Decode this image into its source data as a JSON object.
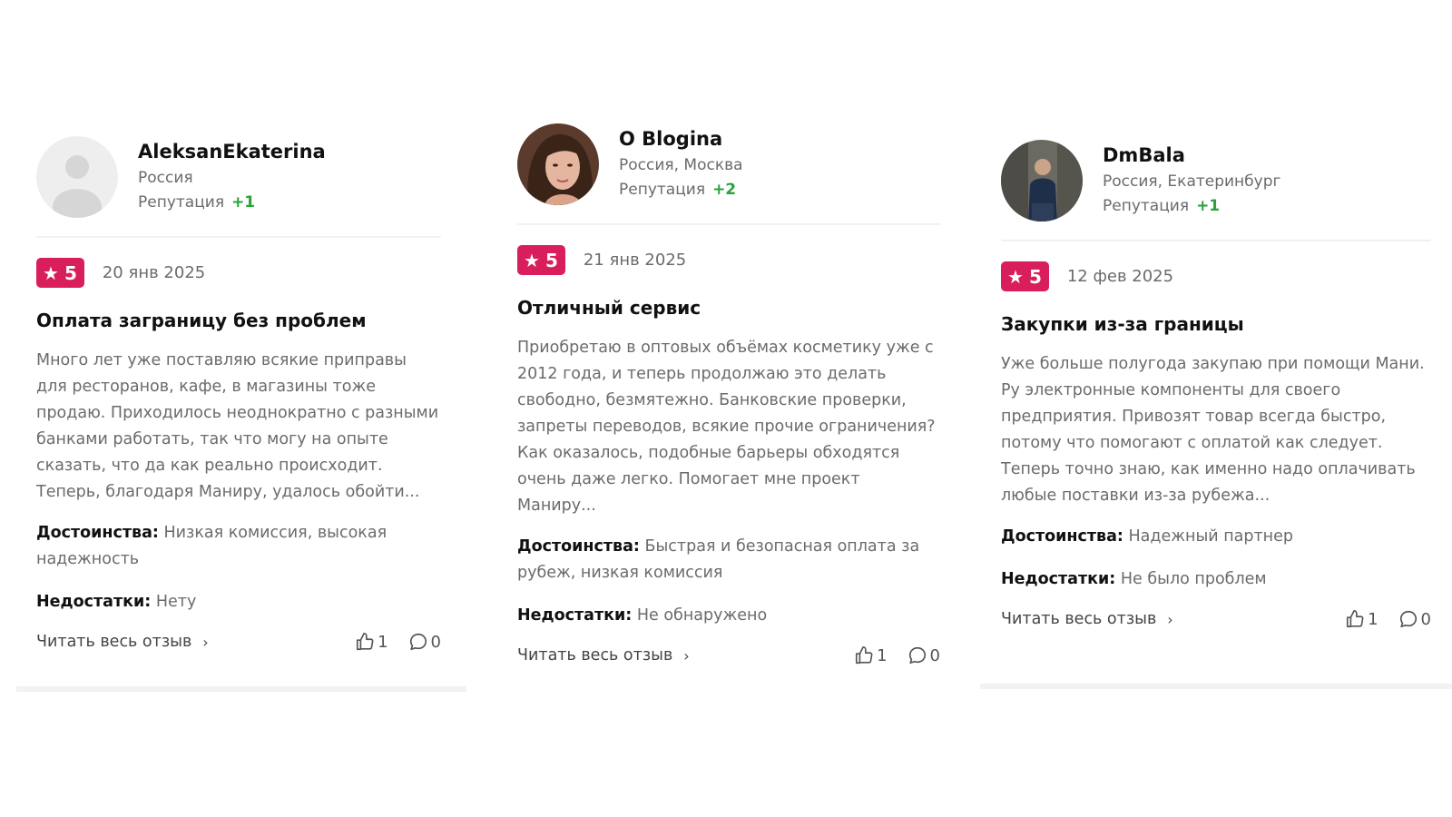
{
  "reviews": [
    {
      "author": "AleksanEkaterina",
      "location": "Россия",
      "reputation_label": "Репутация",
      "reputation_value": "+1",
      "avatar": "default-avatar-icon",
      "rating": "5",
      "date": "20 янв 2025",
      "title": "Оплата заграницу без проблем",
      "text": "Много лет уже поставляю всякие приправы для ресторанов, кафе, в магазины тоже продаю. Приходилось неоднократно с разными банками работать, так что могу на опыте сказать, что да как реально происходит. Теперь, благодаря Маниру, удалось обойти...",
      "pros_label": "Достоинства:",
      "pros": "Низкая комиссия, высокая надежность",
      "cons_label": "Недостатки:",
      "cons": "Нету",
      "read_more": "Читать весь отзыв",
      "likes": "1",
      "comments": "0"
    },
    {
      "author": "O Blogina",
      "location": "Россия, Москва",
      "reputation_label": "Репутация",
      "reputation_value": "+2",
      "avatar": "user-photo",
      "rating": "5",
      "date": "21 янв 2025",
      "title": "Отличный сервис",
      "text": "Приобретаю в оптовых объёмах косметику уже с 2012 года, и теперь продолжаю это делать свободно, безмятежно. Банковские проверки, запреты переводов, всякие прочие ограничения? Как оказалось, подобные барьеры обходятся очень даже легко. Помогает мне проект Маниру...",
      "pros_label": "Достоинства:",
      "pros": "Быстрая и безопасная оплата за рубеж, низкая комиссия",
      "cons_label": "Недостатки:",
      "cons": "Не обнаружено",
      "read_more": "Читать весь отзыв",
      "likes": "1",
      "comments": "0"
    },
    {
      "author": "DmBala",
      "location": "Россия, Екатеринбург",
      "reputation_label": "Репутация",
      "reputation_value": "+1",
      "avatar": "user-photo",
      "rating": "5",
      "date": "12 фев 2025",
      "title": "Закупки из-за границы",
      "text": "Уже больше полугода закупаю при помощи Мани. Ру электронные компоненты для своего предприятия. Привозят товар всегда быстро, потому что помогают с оплатой как следует. Теперь точно знаю, как именно надо оплачивать любые поставки из-за рубежа...",
      "pros_label": "Достоинства:",
      "pros": "Надежный партнер",
      "cons_label": "Недостатки:",
      "cons": "Не было проблем",
      "read_more": "Читать весь отзыв",
      "likes": "1",
      "comments": "0"
    }
  ],
  "colors": {
    "badge": "#d81e5b",
    "reputation": "#2aa23a",
    "muted_text": "#6b6b6b"
  }
}
